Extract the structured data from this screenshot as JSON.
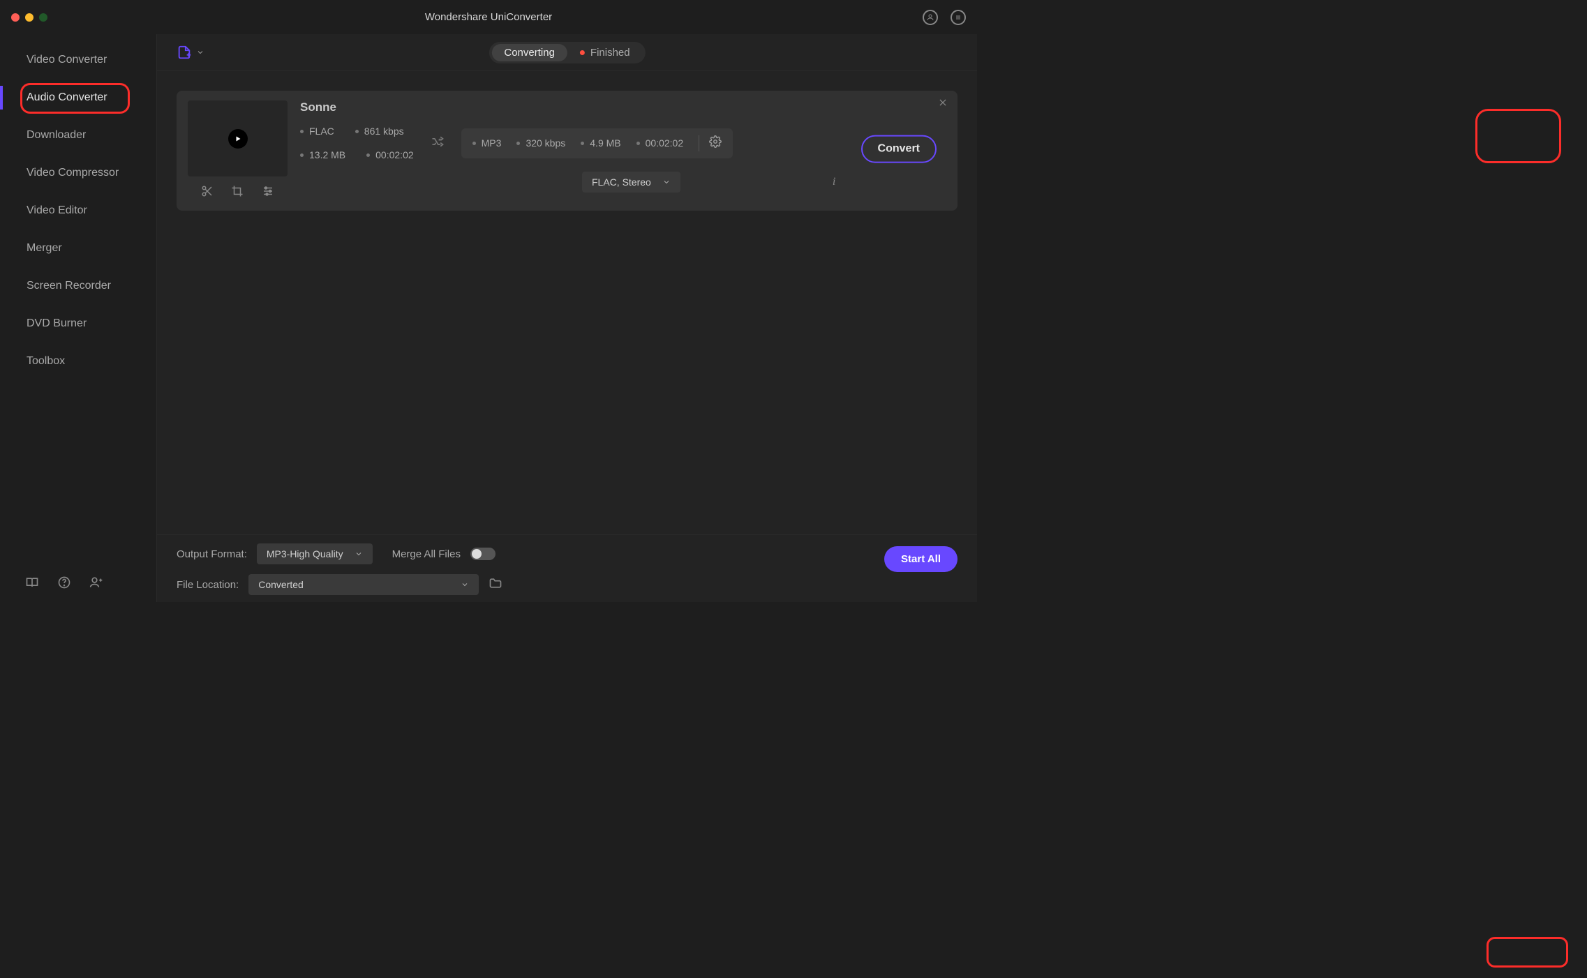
{
  "app_title": "Wondershare UniConverter",
  "sidebar": {
    "items": [
      {
        "label": "Video Converter"
      },
      {
        "label": "Audio Converter"
      },
      {
        "label": "Downloader"
      },
      {
        "label": "Video Compressor"
      },
      {
        "label": "Video Editor"
      },
      {
        "label": "Merger"
      },
      {
        "label": "Screen Recorder"
      },
      {
        "label": "DVD Burner"
      },
      {
        "label": "Toolbox"
      }
    ],
    "active_index": 1
  },
  "topbar": {
    "tabs": {
      "converting": "Converting",
      "finished": "Finished"
    }
  },
  "file": {
    "title": "Sonne",
    "source": {
      "format": "FLAC",
      "bitrate": "861 kbps",
      "size": "13.2 MB",
      "duration": "00:02:02"
    },
    "target": {
      "format": "MP3",
      "bitrate": "320 kbps",
      "size": "4.9 MB",
      "duration": "00:02:02"
    },
    "format_selected": "FLAC, Stereo",
    "convert_label": "Convert"
  },
  "bottom": {
    "output_format_label": "Output Format:",
    "output_format_value": "MP3-High Quality",
    "merge_label": "Merge All Files",
    "file_location_label": "File Location:",
    "file_location_value": "Converted",
    "start_all_label": "Start All"
  }
}
